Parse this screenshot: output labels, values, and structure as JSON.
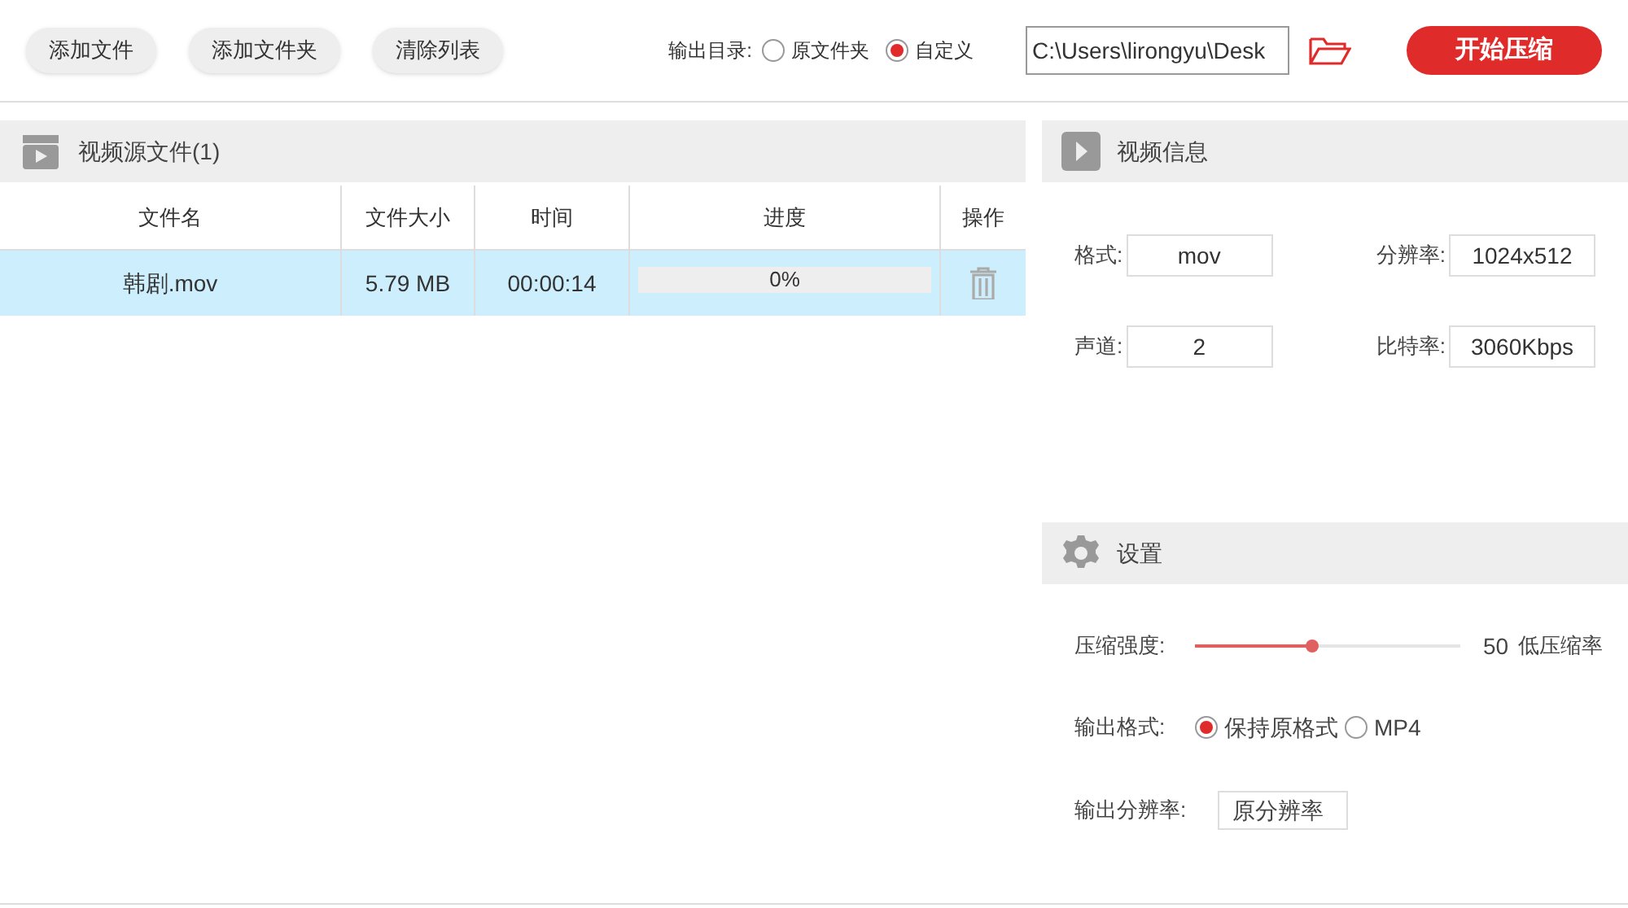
{
  "toolbar": {
    "buttons": [
      "添加文件",
      "添加文件夹",
      "清除列表"
    ],
    "output_dir": {
      "label": "输出目录:",
      "options": [
        {
          "label": "原文件夹",
          "selected": false
        },
        {
          "label": "自定义",
          "selected": true
        }
      ],
      "path": "C:\\Users\\lirongyu\\Desk"
    },
    "start_button": "开始压缩"
  },
  "source_panel": {
    "title": "视频源文件(1)",
    "columns": [
      "文件名",
      "文件大小",
      "时间",
      "进度",
      "操作"
    ],
    "rows": [
      {
        "name": "韩剧.mov",
        "size": "5.79 MB",
        "time": "00:00:14",
        "progress": "0%",
        "selected": true
      }
    ]
  },
  "info_panel": {
    "title": "视频信息",
    "fields": [
      {
        "label": "格式:",
        "value": "mov"
      },
      {
        "label": "分辨率:",
        "value": "1024x512"
      },
      {
        "label": "声道:",
        "value": "2"
      },
      {
        "label": "比特率:",
        "value": "3060Kbps"
      }
    ]
  },
  "settings_panel": {
    "title": "设置",
    "strength": {
      "label": "压缩强度:",
      "level": 0.44,
      "value": "50",
      "hint": "低压缩率"
    },
    "format": {
      "label": "输出格式:",
      "options": [
        {
          "label": "保持原格式",
          "selected": true
        },
        {
          "label": "MP4",
          "selected": false
        }
      ]
    },
    "resolution": {
      "label": "输出分辨率:",
      "value": "原分辨率"
    }
  }
}
